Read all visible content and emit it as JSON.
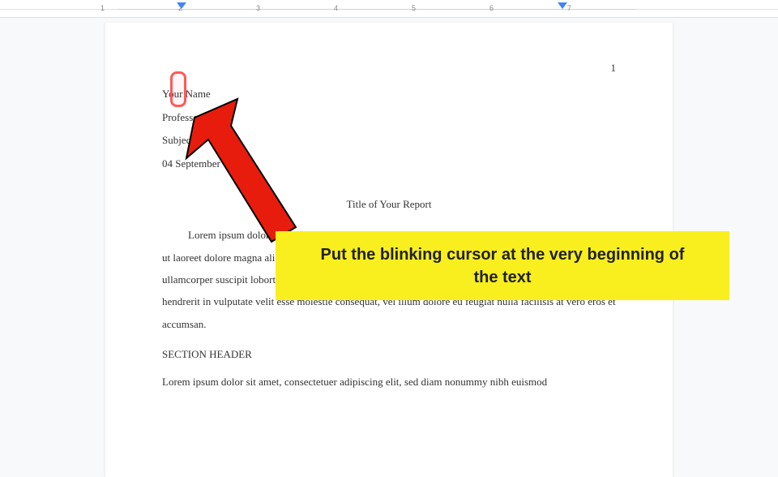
{
  "ruler": {
    "numbers": [
      "1",
      "2",
      "3",
      "4",
      "5",
      "6",
      "7"
    ]
  },
  "doc": {
    "page_number": "1",
    "header": {
      "your_name": "Your Name",
      "professor": "Professor Name",
      "subject": "Subject",
      "date": "04 September"
    },
    "title": "Title of Your Report",
    "para1": "Lorem ipsum dolor sit amet, consectetuer adipiscing elit, sed diam nonummy nibh euismod tincidunt ut laoreet dolore magna aliquam erat volutpat. Ut wisi enim ad minim veniam, quis nostrud exerci tation ullamcorper suscipit lobortis nisl ut aliquip ex ea commodo consequat. Duis autem vel eum iriure dolor in hendrerit in vulputate velit esse molestie consequat, vel illum dolore eu feugiat nulla facilisis at vero eros et accumsan.",
    "section_header": "SECTION HEADER",
    "para2": "Lorem ipsum dolor sit amet, consectetuer adipiscing elit, sed diam nonummy nibh euismod"
  },
  "callout": "Put the blinking cursor at the very beginning of the text"
}
